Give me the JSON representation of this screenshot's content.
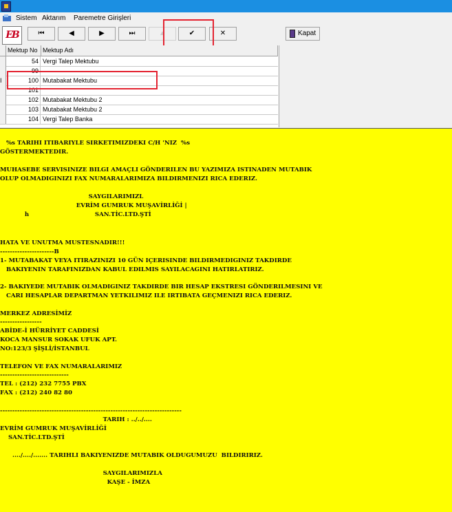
{
  "menu": {
    "items": [
      "Sistem",
      "Aktarım",
      "Paremetre Girişleri"
    ]
  },
  "toolbar": {
    "logo": "EB",
    "first": "⏮",
    "prev": "◀",
    "next": "▶",
    "last": "⏭",
    "edit": "▲",
    "save": "✔",
    "cancel": "✕",
    "close_label": "Kapat"
  },
  "grid": {
    "columns": [
      "Mektup No",
      "Mektup Adı"
    ],
    "current_row_indicator": "I",
    "rows": [
      {
        "no": "54",
        "name": "Vergi Talep Mektubu"
      },
      {
        "no": "99",
        "name": ""
      },
      {
        "no": "100",
        "name": "Mutabakat Mektubu"
      },
      {
        "no": "101",
        "name": ""
      },
      {
        "no": "102",
        "name": "Mutabakat Mektubu 2"
      },
      {
        "no": "103",
        "name": "Mutabakat Mektubu 2"
      },
      {
        "no": "104",
        "name": "Vergi Talep Banka"
      }
    ]
  },
  "document": {
    "lines": [
      "   %s TARIHI ITIBARIYLE SIRKETIMIZDEKI C/H 'NIZ  %s",
      "GÖSTERMEKTEDIR.",
      "",
      "MUHASEBE SERVISINIZE BILGI AMAÇLI GÖNDERILEN BU YAZIMIZA ISTINADEN MUTABIK",
      "OLUP OLMADIGINIZI FAX NUMARALARIMIZA BILDIRMENIZI RICA EDERIZ.",
      "",
      "                                           SAYGILARIMIZL",
      "                                     EVRİM GUMRUK MUŞAVİRLİĞİ |",
      "            h                                SAN.TİC.LTD.ŞTİ",
      "",
      "",
      "",
      "HATA VE UNUTMA MUSTESNADIR!!!",
      "----------------------B",
      "1- MUTABAKAT VEYA ITIRAZINIZI 10 GÜN IÇERISINDE BILDIRMEDIGINIZ TAKDIRDE",
      "   BAKIYENIN TARAFINIZDAN KABUL EDILMIS SAYILACAGINI HATIRLATIRIZ.",
      "",
      "2- BAKIYEDE MUTABIK OLMADIGINIZ TAKDIRDE BIR HESAP EKSTRESI GÖNDERILMESINI VE",
      "   CARI HESAPLAR DEPARTMAN YETKILIMIZ ILE IRTIBATA GEÇMENIZI RICA EDERIZ.",
      "",
      "MERKEZ ADRESİMİZ",
      "-----------------",
      "ABİDE-İ HÜRRİYET CADDESİ",
      "KOCA MANSUR SOKAK UFUK APT.",
      "NO:123/3 ŞİŞLİ/İSTANBUL",
      "",
      "TELEFON VE FAX NUMARALARIMIZ",
      "----------------------------",
      "TEL : (212) 232 7755 PBX",
      "FAX : (212) 240 82 80",
      "",
      "--------------------------------------------------------------------------",
      "                                                  TARIH : ../../....",
      "EVRİM GUMRUK MUŞAVİRLİĞİ",
      "    SAN.TİC.LTD.ŞTİ",
      "",
      "      ..../..../....... TARIHLI BAKIYENIZDE MUTABIK OLDUGUMUZU  BILDIRIRIZ.",
      "",
      "                                                  SAYGILARIMIZLA",
      "                                                    KAŞE - İMZA"
    ]
  }
}
